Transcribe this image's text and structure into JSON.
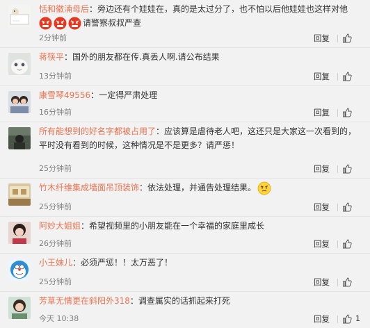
{
  "reply_label": "回复",
  "comments": [
    {
      "username": "恬和徽湳母后",
      "separator": "：",
      "text": "旁边还有个娃娃在，真的是太过分了，也不怕以后他娃娃也这样对他",
      "text2": "请警察叔叔严查",
      "emoji_count": 3,
      "time": "2分钟前",
      "likes": ""
    },
    {
      "username": "蒋筷平",
      "separator": "：",
      "text": "国外的朋友都在传.真丢人啊.请公布结果",
      "time": "13分钟前",
      "likes": ""
    },
    {
      "username": "康雪琴49556",
      "separator": "：",
      "text": "一定得严肃处理",
      "time": "16分钟前",
      "likes": ""
    },
    {
      "username": "所有能想到的好名字都被占用了",
      "separator": "：",
      "text": "应该算是虐待老人吧，这还只是大家这一次看到的，",
      "text2": "平时没有看到的时候，这种情况是不是更多？请严惩！",
      "time": "25分钟前",
      "likes": ""
    },
    {
      "username": "竹木纤维集成墙面吊顶装饰",
      "separator": "：",
      "text": "依法处理，并通告处理结果。",
      "time": "25分钟前",
      "likes": ""
    },
    {
      "username": "阿妙大姐姐",
      "separator": "：",
      "text": "希望视频里的小朋友能在一个幸福的家庭里成长",
      "time": "26分钟前",
      "likes": ""
    },
    {
      "username": "小王妹儿",
      "separator": "：",
      "text": "必须严惩！！太万恶了！",
      "time": "25分钟前",
      "likes": ""
    },
    {
      "username": "芳草无情更在斜阳外318",
      "separator": "：",
      "text": "调查属实的话抓起来打死",
      "time": "今天 10:38",
      "likes": "1"
    }
  ]
}
